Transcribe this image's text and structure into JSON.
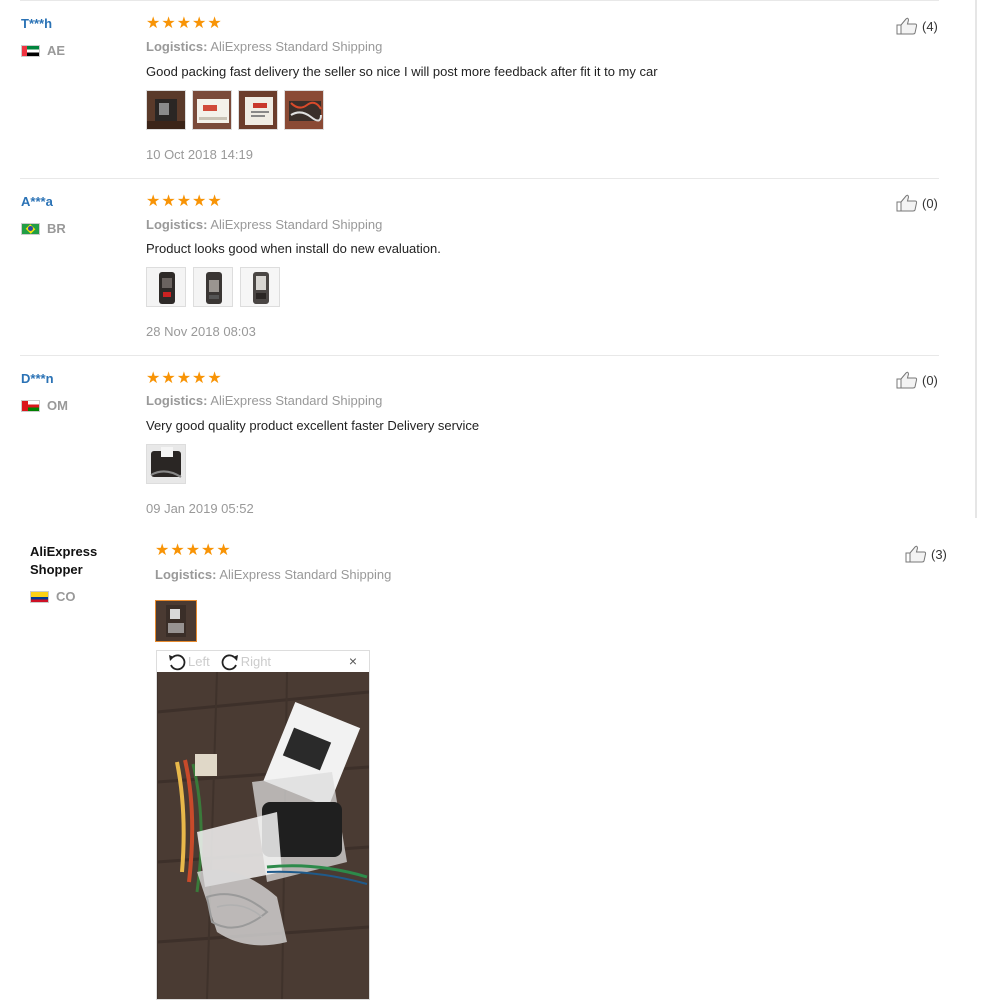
{
  "reviews": [
    {
      "user": "T***h",
      "country": "AE",
      "logistics_label": "Logistics:",
      "logistics_value": "AliExpress Standard Shipping",
      "text": "Good packing fast delivery the seller so nice I will post more feedback after fit it to my car",
      "date": "10 Oct 2018 14:19",
      "helpful": "(4)",
      "rating": 5
    },
    {
      "user": "A***a",
      "country": "BR",
      "logistics_label": "Logistics:",
      "logistics_value": "AliExpress Standard Shipping",
      "text": "Product looks good when install do new evaluation.",
      "date": "28 Nov 2018 08:03",
      "helpful": "(0)",
      "rating": 5
    },
    {
      "user": "D***n",
      "country": "OM",
      "logistics_label": "Logistics:",
      "logistics_value": "AliExpress Standard Shipping",
      "text": "Very good quality product excellent faster Delivery service",
      "date": "09 Jan 2019 05:52",
      "helpful": "(0)",
      "rating": 5
    },
    {
      "user": "AliExpress Shopper",
      "country": "CO",
      "logistics_label": "Logistics:",
      "logistics_value": "AliExpress Standard Shipping",
      "helpful": "(3)",
      "rating": 5
    }
  ],
  "viewer": {
    "rotate_left": "Left",
    "rotate_right": "Right",
    "close": "×"
  },
  "icons": {
    "star": "star-icon",
    "like": "thumbs-up-icon",
    "rotate_left": "rotate-left-icon",
    "rotate_right": "rotate-right-icon",
    "close": "close-icon"
  },
  "colors": {
    "star": "#f89406",
    "username": "#2a72b5",
    "muted": "#999999",
    "active_thumb_border": "#e68a2e"
  }
}
